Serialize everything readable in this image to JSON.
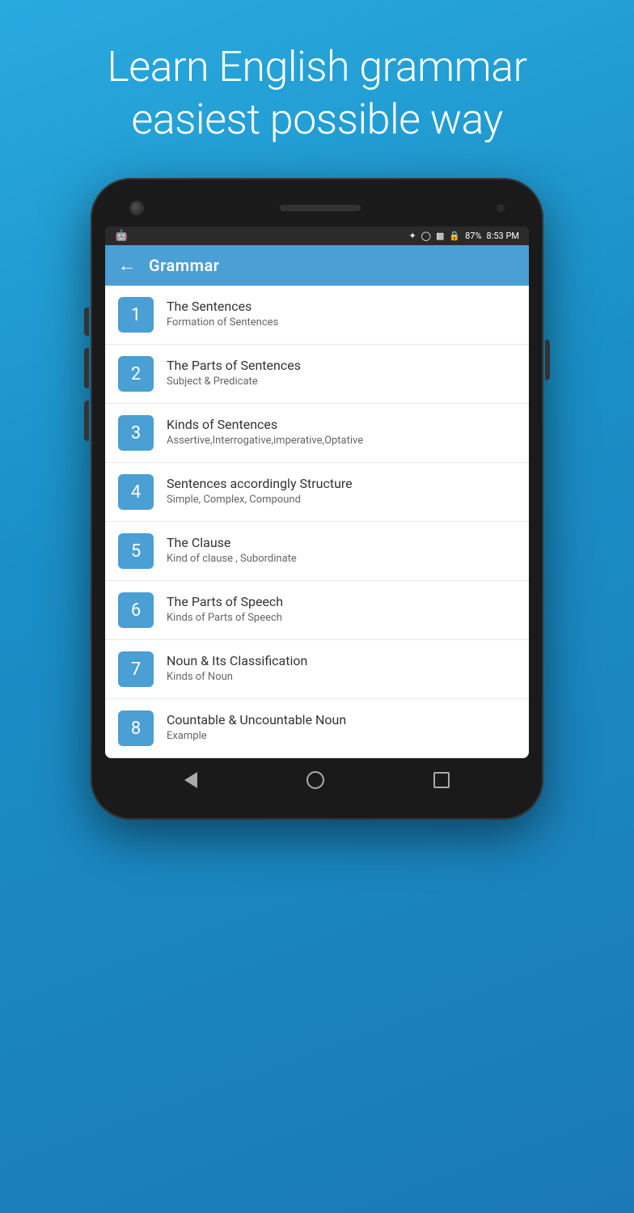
{
  "hero": {
    "line1": "Learn English grammar",
    "line2": "easiest possible way"
  },
  "status_bar": {
    "battery": "87%",
    "time": "8:53 PM",
    "icons": [
      "bluetooth",
      "clock",
      "signal",
      "lock",
      "battery"
    ]
  },
  "toolbar": {
    "title": "Grammar",
    "back_label": "←"
  },
  "nav": {
    "back_label": "‹",
    "home_label": "○",
    "recents_label": "□"
  },
  "items": [
    {
      "number": "1",
      "title": "The Sentences",
      "subtitle": "Formation of Sentences"
    },
    {
      "number": "2",
      "title": "The Parts of Sentences",
      "subtitle": "Subject & Predicate"
    },
    {
      "number": "3",
      "title": "Kinds of Sentences",
      "subtitle": "Assertive,Interrogative,imperative,Optative"
    },
    {
      "number": "4",
      "title": "Sentences accordingly Structure",
      "subtitle": "Simple, Complex, Compound"
    },
    {
      "number": "5",
      "title": "The Clause",
      "subtitle": "Kind of clause , Subordinate"
    },
    {
      "number": "6",
      "title": "The Parts of Speech",
      "subtitle": "Kinds of Parts of Speech"
    },
    {
      "number": "7",
      "title": "Noun & Its Classification",
      "subtitle": "Kinds of Noun"
    },
    {
      "number": "8",
      "title": "Countable & Uncountable Noun",
      "subtitle": "Example"
    }
  ]
}
